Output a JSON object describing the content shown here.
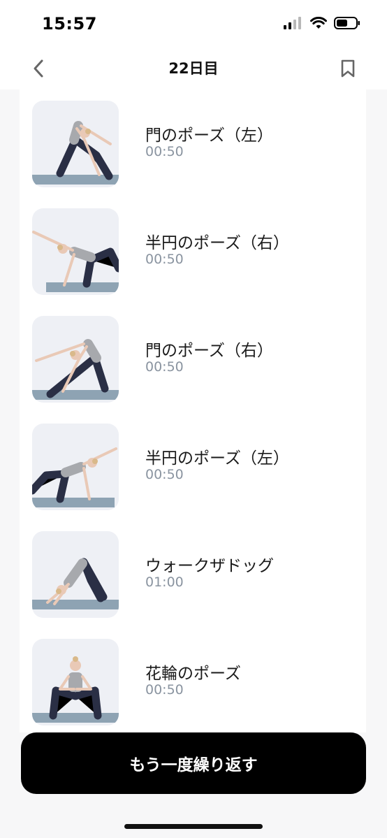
{
  "status_bar": {
    "time": "15:57",
    "icons": [
      "cellular-signal-icon",
      "wifi-icon",
      "battery-icon"
    ]
  },
  "nav": {
    "title": "22日目",
    "back_icon": "chevron-left-icon",
    "bookmark_icon": "bookmark-icon"
  },
  "exercises": [
    {
      "name": "門のポーズ（左）",
      "duration": "00:50"
    },
    {
      "name": "半円のポーズ（右）",
      "duration": "00:50"
    },
    {
      "name": "門のポーズ（右）",
      "duration": "00:50"
    },
    {
      "name": "半円のポーズ（左）",
      "duration": "00:50"
    },
    {
      "name": "ウォークザドッグ",
      "duration": "01:00"
    },
    {
      "name": "花輪のポーズ",
      "duration": "00:50"
    }
  ],
  "repeat_button": {
    "label": "もう一度繰り返す"
  },
  "colors": {
    "background": "#f7f7f8",
    "card": "#ffffff",
    "duration_text": "#8a94a0",
    "button": "#000000",
    "mat": "#8ea3b3"
  }
}
